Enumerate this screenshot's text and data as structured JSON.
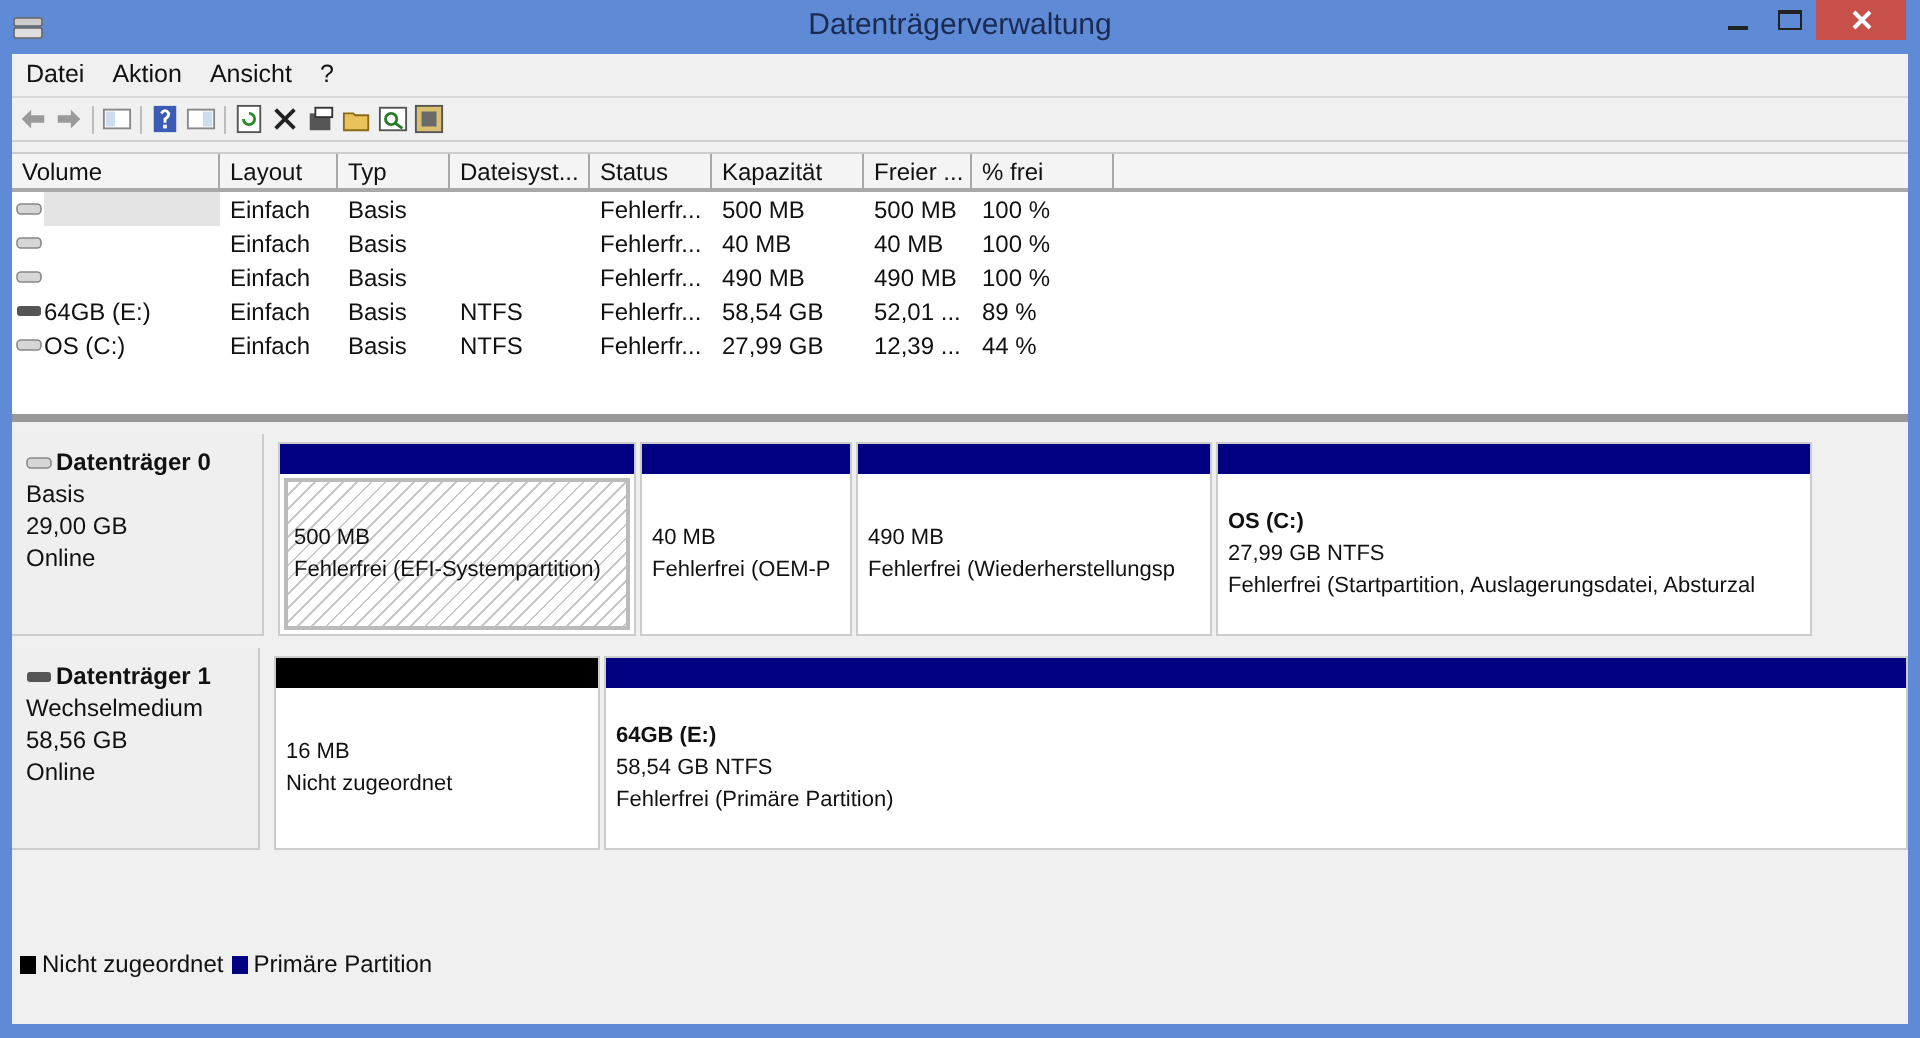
{
  "window": {
    "title": "Datenträgerverwaltung"
  },
  "menu": [
    "Datei",
    "Aktion",
    "Ansicht",
    "?"
  ],
  "table": {
    "columns": [
      "Volume",
      "Layout",
      "Typ",
      "Dateisyst...",
      "Status",
      "Kapazität",
      "Freier ...",
      "% frei"
    ],
    "rows": [
      {
        "kind": "fixed",
        "selected": true,
        "cells": [
          "",
          "Einfach",
          "Basis",
          "",
          "Fehlerfr...",
          "500 MB",
          "500 MB",
          "100 %"
        ]
      },
      {
        "kind": "fixed",
        "selected": false,
        "cells": [
          "",
          "Einfach",
          "Basis",
          "",
          "Fehlerfr...",
          "40 MB",
          "40 MB",
          "100 %"
        ]
      },
      {
        "kind": "fixed",
        "selected": false,
        "cells": [
          "",
          "Einfach",
          "Basis",
          "",
          "Fehlerfr...",
          "490 MB",
          "490 MB",
          "100 %"
        ]
      },
      {
        "kind": "removable",
        "selected": false,
        "cells": [
          "64GB (E:)",
          "Einfach",
          "Basis",
          "NTFS",
          "Fehlerfr...",
          "58,54 GB",
          "52,01 ...",
          "89 %"
        ]
      },
      {
        "kind": "fixed",
        "selected": false,
        "cells": [
          "OS (C:)",
          "Einfach",
          "Basis",
          "NTFS",
          "Fehlerfr...",
          "27,99 GB",
          "12,39 ...",
          "44 %"
        ]
      }
    ]
  },
  "disks": [
    {
      "kind": "fixed",
      "name": "Datenträger 0",
      "type": "Basis",
      "size": "29,00 GB",
      "state": "Online",
      "partitions": [
        {
          "color": "#000080",
          "selected": true,
          "lines": [
            "500 MB",
            "Fehlerfrei (EFI-Systempartition)"
          ]
        },
        {
          "color": "#000080",
          "selected": false,
          "lines": [
            "40 MB",
            "Fehlerfrei (OEM-P"
          ]
        },
        {
          "color": "#000080",
          "selected": false,
          "lines": [
            "490 MB",
            "Fehlerfrei (Wiederherstellungsp"
          ]
        },
        {
          "color": "#000080",
          "selected": false,
          "label": "OS  (C:)",
          "lines": [
            "27,99 GB NTFS",
            "Fehlerfrei (Startpartition, Auslagerungsdatei, Absturzal"
          ]
        }
      ]
    },
    {
      "kind": "removable",
      "name": "Datenträger 1",
      "type": "Wechselmedium",
      "size": "58,56 GB",
      "state": "Online",
      "partitions": [
        {
          "color": "#000000",
          "selected": false,
          "lines": [
            "16 MB",
            "Nicht zugeordnet"
          ]
        },
        {
          "color": "#000080",
          "selected": false,
          "label": "64GB  (E:)",
          "lines": [
            "58,54 GB NTFS",
            "Fehlerfrei (Primäre Partition)"
          ]
        }
      ]
    }
  ],
  "legend": [
    {
      "color": "#000000",
      "label": "Nicht zugeordnet"
    },
    {
      "color": "#000080",
      "label": "Primäre Partition"
    }
  ]
}
